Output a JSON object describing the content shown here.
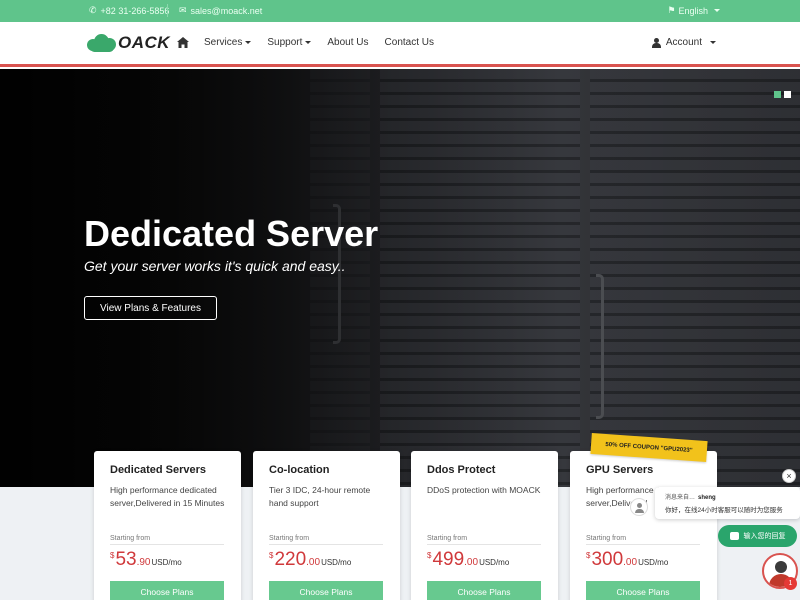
{
  "topbar": {
    "phone": "+82 31-266-5856",
    "email": "sales@moack.net",
    "language": "English"
  },
  "nav": {
    "logo_text": "OACK",
    "items": [
      "Services",
      "Support",
      "About Us",
      "Contact Us"
    ],
    "account": "Account"
  },
  "hero": {
    "title": "Dedicated Server",
    "subtitle": "Get your server works it's quick and easy..",
    "button": "View Plans & Features"
  },
  "coupon": "50% OFF COUPON \"GPU2023\"",
  "plans": [
    {
      "name": "Dedicated Servers",
      "desc": "High performance dedicated server,Delivered in 15 Minutes",
      "from": "Starting from",
      "currency": "$",
      "price": "53",
      "cents": ".90",
      "unit": "USD",
      "per": "/mo",
      "button": "Choose Plans"
    },
    {
      "name": "Co-location",
      "desc": "Tier 3 IDC, 24-hour remote hand support",
      "from": "Starting from",
      "currency": "$",
      "price": "220",
      "cents": ".00",
      "unit": "USD",
      "per": "/mo",
      "button": "Choose Plans"
    },
    {
      "name": "Ddos Protect",
      "desc": "DDoS protection with MOACK",
      "from": "Starting from",
      "currency": "$",
      "price": "499",
      "cents": ".00",
      "unit": "USD",
      "per": "/mo",
      "button": "Choose Plans"
    },
    {
      "name": "GPU Servers",
      "desc": "High performance GPU server,Delivered",
      "from": "Starting from",
      "currency": "$",
      "price": "300",
      "cents": ".00",
      "unit": "USD",
      "per": "/mo",
      "button": "Choose Plans"
    }
  ],
  "chat": {
    "close": "×",
    "from_label": "消息来自…",
    "agent": "sheng",
    "message": "你好，在线24小时客服可以随时为您服务",
    "input_button": "输入您的回复",
    "badge": "1"
  },
  "colors": {
    "primary": "#5fc48b",
    "accent_red": "#d9534f",
    "price_red": "#d0393b"
  }
}
